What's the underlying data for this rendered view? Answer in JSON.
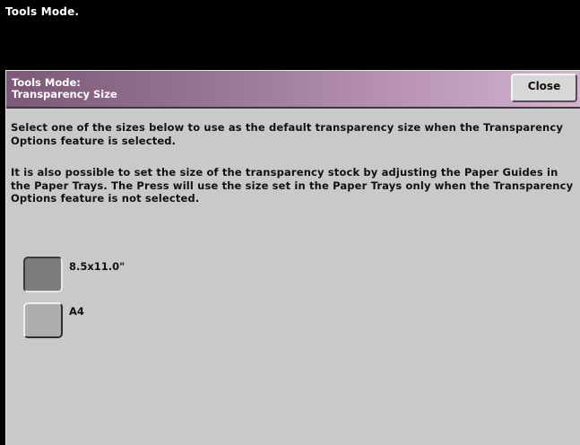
{
  "window": {
    "title": "Tools Mode."
  },
  "header": {
    "title_line1": "Tools Mode:",
    "title_line2": "Transparency Size",
    "close_label": "Close"
  },
  "instructions": {
    "paragraph1": "Select one of the sizes below to use as the default transparency size when the Transparency Options feature is selected.",
    "paragraph2": "It is also possible to set the size of the transparency stock by adjusting the Paper Guides in the Paper Trays.  The Press will use the size set in the Paper Trays only when the Transparency Options feature is not selected."
  },
  "options": [
    {
      "label": "8.5x11.0\"",
      "selected": true
    },
    {
      "label": "A4",
      "selected": false
    }
  ],
  "colors": {
    "header_gradient_start": "#7c5979",
    "header_gradient_end": "#d5b3d1",
    "panel_background": "#c9c9c9",
    "selected_button": "#7c7c7c",
    "unselected_button": "#aeaeae"
  }
}
